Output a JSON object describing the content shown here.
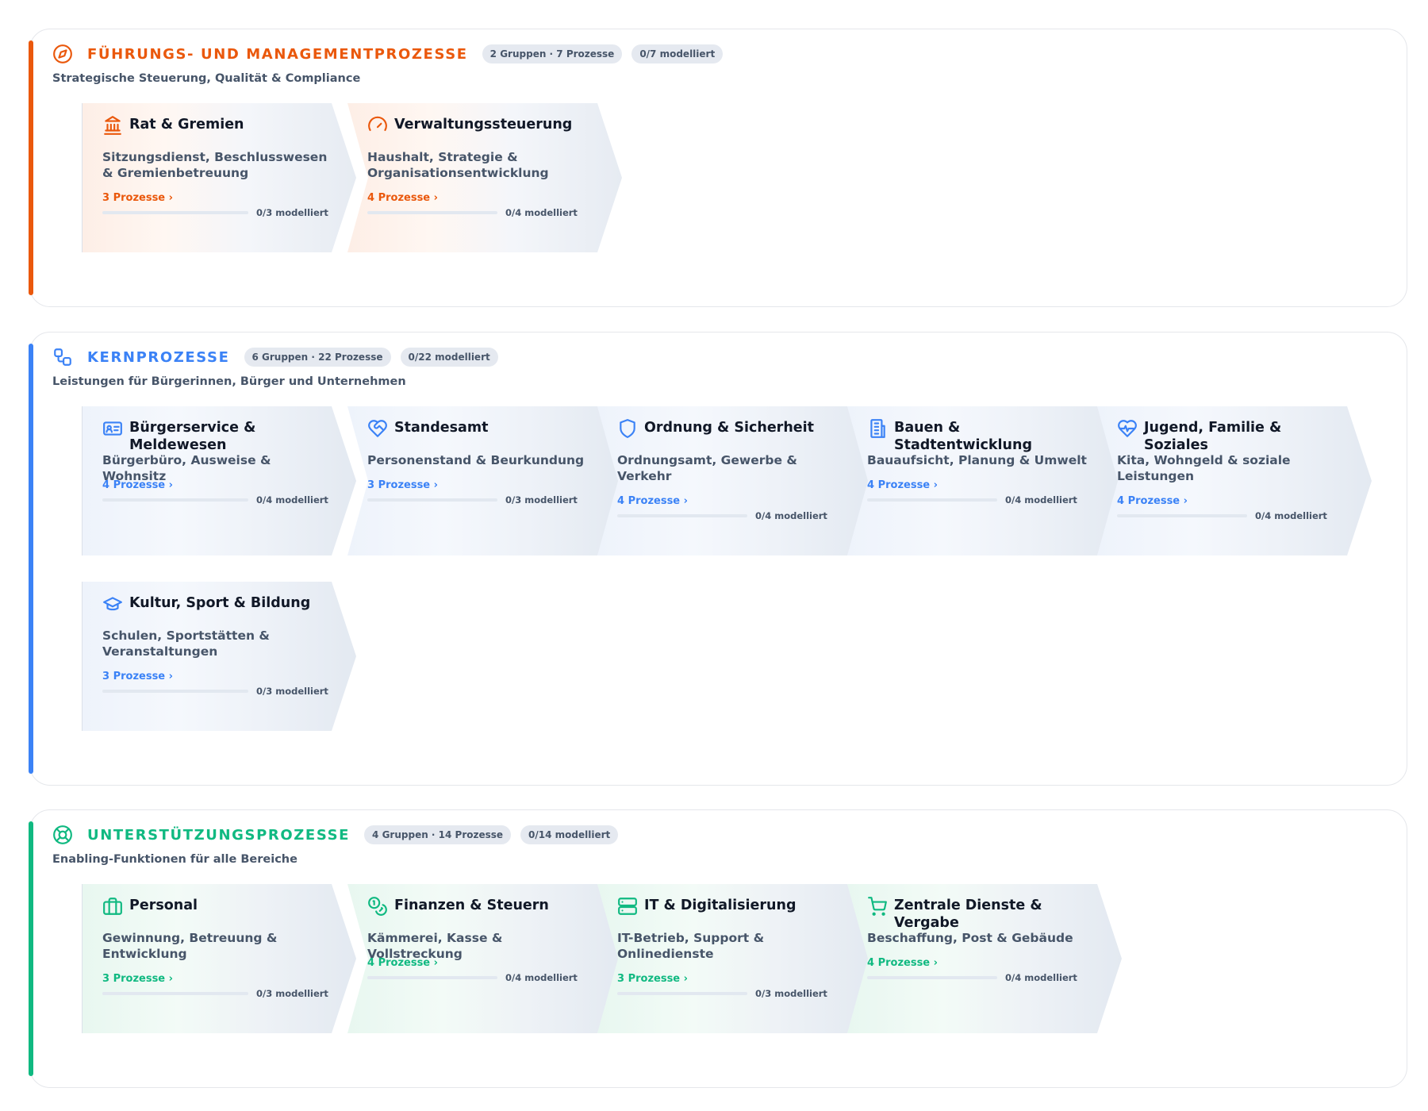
{
  "colors": {
    "management": "#ea580c",
    "core": "#3b82f6",
    "support": "#10b981"
  },
  "sections": [
    {
      "id": "management",
      "icon": "compass-icon",
      "title": "FÜHRUNGS- UND MANAGEMENTPROZESSE",
      "groups_badge": "2 Gruppen · 7 Prozesse",
      "modeled_badge": "0/7 modelliert",
      "subtitle": "Strategische Steuerung, Qualität & Compliance",
      "cards": [
        {
          "icon": "bank-icon",
          "title": "Rat & Gremien",
          "desc": "Sitzungsdienst, Beschlusswesen & Gremienbetreuung",
          "link": "3 Prozesse ›",
          "progress": "0/3 modelliert",
          "progress_value": 0
        },
        {
          "icon": "gauge-icon",
          "title": "Verwaltungssteuerung",
          "desc": "Haushalt, Strategie & Organisationsentwicklung",
          "link": "4 Prozesse ›",
          "progress": "0/4 modelliert",
          "progress_value": 0
        }
      ]
    },
    {
      "id": "core",
      "icon": "workflow-icon",
      "title": "KERNPROZESSE",
      "groups_badge": "6 Gruppen · 22 Prozesse",
      "modeled_badge": "0/22 modelliert",
      "subtitle": "Leistungen für Bürgerinnen, Bürger und Unternehmen",
      "cards": [
        {
          "icon": "id-card-icon",
          "title": "Bürgerservice & Meldewesen",
          "desc": "Bürgerbüro, Ausweise & Wohnsitz",
          "link": "4 Prozesse ›",
          "progress": "0/4 modelliert",
          "progress_value": 0
        },
        {
          "icon": "heart-handshake-icon",
          "title": "Standesamt",
          "desc": "Personenstand & Beurkundung",
          "link": "3 Prozesse ›",
          "progress": "0/3 modelliert",
          "progress_value": 0
        },
        {
          "icon": "shield-icon",
          "title": "Ordnung & Sicherheit",
          "desc": "Ordnungsamt, Gewerbe & Verkehr",
          "link": "4 Prozesse ›",
          "progress": "0/4 modelliert",
          "progress_value": 0
        },
        {
          "icon": "building-icon",
          "title": "Bauen & Stadtentwicklung",
          "desc": "Bauaufsicht, Planung & Umwelt",
          "link": "4 Prozesse ›",
          "progress": "0/4 modelliert",
          "progress_value": 0
        },
        {
          "icon": "heart-pulse-icon",
          "title": "Jugend, Familie & Soziales",
          "desc": "Kita, Wohngeld & soziale Leistungen",
          "link": "4 Prozesse ›",
          "progress": "0/4 modelliert",
          "progress_value": 0
        },
        {
          "icon": "graduation-cap-icon",
          "title": "Kultur, Sport & Bildung",
          "desc": "Schulen, Sportstätten & Veranstaltungen",
          "link": "3 Prozesse ›",
          "progress": "0/3 modelliert",
          "progress_value": 0
        }
      ]
    },
    {
      "id": "support",
      "icon": "lifebuoy-icon",
      "title": "UNTERSTÜTZUNGSPROZESSE",
      "groups_badge": "4 Gruppen · 14 Prozesse",
      "modeled_badge": "0/14 modelliert",
      "subtitle": "Enabling-Funktionen für alle Bereiche",
      "cards": [
        {
          "icon": "briefcase-icon",
          "title": "Personal",
          "desc": "Gewinnung, Betreuung & Entwicklung",
          "link": "3 Prozesse ›",
          "progress": "0/3 modelliert",
          "progress_value": 0
        },
        {
          "icon": "coins-icon",
          "title": "Finanzen & Steuern",
          "desc": "Kämmerei, Kasse & Vollstreckung",
          "link": "4 Prozesse ›",
          "progress": "0/4 modelliert",
          "progress_value": 0
        },
        {
          "icon": "server-icon",
          "title": "IT & Digitalisierung",
          "desc": "IT-Betrieb, Support & Onlinedienste",
          "link": "3 Prozesse ›",
          "progress": "0/3 modelliert",
          "progress_value": 0
        },
        {
          "icon": "cart-icon",
          "title": "Zentrale Dienste & Vergabe",
          "desc": "Beschaffung, Post & Gebäude",
          "link": "4 Prozesse ›",
          "progress": "0/4 modelliert",
          "progress_value": 0
        }
      ]
    }
  ]
}
